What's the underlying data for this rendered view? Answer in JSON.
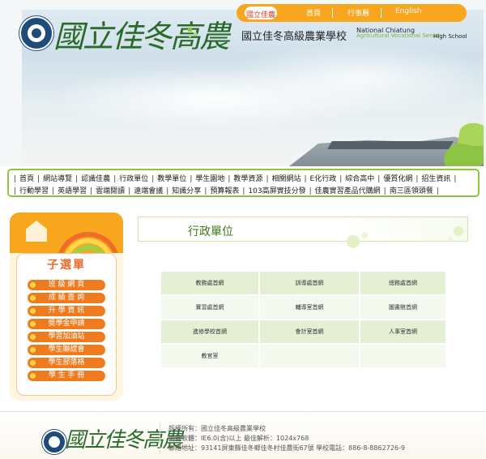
{
  "header": {
    "logo_text": "國立佳冬高農",
    "school_name_cn": "國立佳冬高級農業學校",
    "school_name_en_line1": "National Chiatung",
    "school_name_en_line2": "Agricultural Vocational Senior",
    "school_name_en_line3": "High School",
    "top_nav": [
      {
        "label": "國立佳農"
      },
      {
        "label": "首頁"
      },
      {
        "label": "行事曆"
      },
      {
        "label": "English"
      }
    ]
  },
  "main_nav": {
    "row1": [
      "首頁",
      "網站導覽",
      "認識佳農",
      "行政單位",
      "教學單位",
      "學生園地",
      "教學資源",
      "相關網站",
      "E化行政",
      "綜合高中",
      "優質化網",
      "招生資訊"
    ],
    "row2": [
      "行動學習",
      "英語學習",
      "雲端閱讀",
      "遠端會議",
      "知識分享",
      "預算報表",
      "103高屏實技分發",
      "佳農實習產品代購網",
      "南三區領頭餐"
    ]
  },
  "submenu": {
    "title": "子選單",
    "items": [
      {
        "label": "班 級 網 頁"
      },
      {
        "label": "成 績 查 詢"
      },
      {
        "label": "升 學 資 訊"
      },
      {
        "label": "獎學金申請"
      },
      {
        "label": "學習加油站"
      },
      {
        "label": "學生聯誼會"
      },
      {
        "label": "學生部落格"
      },
      {
        "label": "學 生 手 冊"
      }
    ]
  },
  "main": {
    "page_title": "行政單位",
    "units": [
      [
        "教務處首網",
        "訓導處首網",
        "總務處首網"
      ],
      [
        "實習處首網",
        "輔導室首網",
        "圖書館首網"
      ],
      [
        "進修學校首網",
        "會計室首網",
        "人事室首網"
      ],
      [
        "教官室",
        "",
        ""
      ]
    ]
  },
  "footer": {
    "logo_text": "國立佳冬高農",
    "line1": "版權所有：國立佳冬高級農業學校",
    "line2": "瀏覽軟體：IE6.0(含)以上 最佳解析：1024x768",
    "line3": "聯絡地址：93141屏東縣佳冬鄉佳冬村佳農街67號 學校電話：886-8-8862726-9"
  },
  "colors": {
    "accent_orange": "#f7a61d",
    "accent_green": "#8cc63f",
    "submenu_button": "#f07b1f"
  }
}
